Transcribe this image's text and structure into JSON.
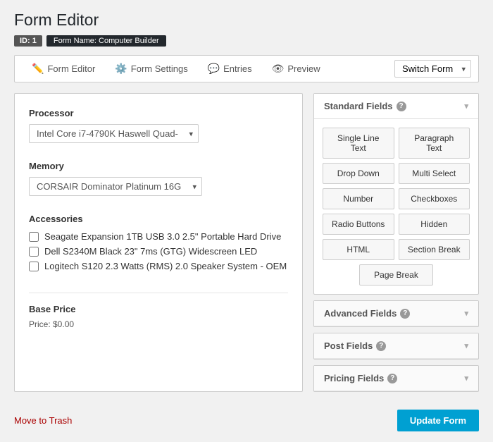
{
  "page": {
    "title": "Form Editor",
    "badges": {
      "id": "ID: 1",
      "name": "Form Name: Computer Builder"
    }
  },
  "nav": {
    "tabs": [
      {
        "id": "form-editor",
        "label": "Form Editor",
        "icon": "✏️"
      },
      {
        "id": "form-settings",
        "label": "Form Settings",
        "icon": "⚙️"
      },
      {
        "id": "entries",
        "label": "Entries",
        "icon": "💬"
      },
      {
        "id": "preview",
        "label": "Preview",
        "icon": "👁"
      }
    ],
    "switch_form_label": "Switch Form",
    "switch_form_placeholder": "Switch Form"
  },
  "fields": {
    "processor": {
      "label": "Processor",
      "value": "Intel Core i7-4790K Haswell Quad-"
    },
    "memory": {
      "label": "Memory",
      "value": "CORSAIR Dominator Platinum 16G"
    },
    "accessories": {
      "label": "Accessories",
      "items": [
        "Seagate Expansion 1TB USB 3.0 2.5\" Portable Hard Drive",
        "Dell S2340M Black 23\" 7ms (GTG) Widescreen LED",
        "Logitech S120 2.3 Watts (RMS) 2.0 Speaker System - OEM"
      ]
    },
    "base_price": {
      "label": "Base Price",
      "value": "Price: $0.00"
    }
  },
  "standard_fields": {
    "title": "Standard Fields",
    "buttons": [
      "Single Line Text",
      "Paragraph Text",
      "Drop Down",
      "Multi Select",
      "Number",
      "Checkboxes",
      "Radio Buttons",
      "Hidden",
      "HTML",
      "Section Break",
      "Page Break"
    ]
  },
  "advanced_fields": {
    "title": "Advanced Fields"
  },
  "post_fields": {
    "title": "Post Fields"
  },
  "pricing_fields": {
    "title": "Pricing Fields"
  },
  "actions": {
    "move_to_trash": "Move to Trash",
    "update_form": "Update Form"
  }
}
